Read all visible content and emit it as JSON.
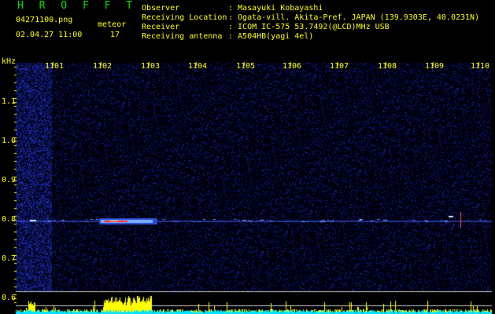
{
  "header": {
    "title": "H R O F F T",
    "filename": "04271100.png",
    "datetime": "02.04.27 11:00",
    "meteor_label": "meteor",
    "meteor_count": "17",
    "info": [
      {
        "label": "Observer",
        "value": ": Masayuki Kobayashi"
      },
      {
        "label": "Receiving Location",
        "value": ": Ogata-vill. Akita-Pref. JAPAN (139.9303E, 40.0231N)"
      },
      {
        "label": "Receiver",
        "value": ": ICOM IC-575 53.7492(@LCD)MHz USB"
      },
      {
        "label": "Receiving antenna",
        "value": ": A504HB(yagi 4el)"
      }
    ]
  },
  "axes": {
    "y_unit": "kHz",
    "y_ticks": [
      "1.1",
      "1.0",
      "0.9",
      "0.8",
      "0.7",
      "0.6"
    ],
    "x_ticks": [
      "1101",
      "1102",
      "1103",
      "1104",
      "1105",
      "1106",
      "1107",
      "1108",
      "1109",
      "1110"
    ]
  },
  "colors": {
    "text": "#ffff00",
    "title": "#00e000",
    "background": "#000000",
    "noise": "#1a2a9a",
    "echo_core": "#ff3030",
    "bars": "#ffff00",
    "baseline": "#00e0ff"
  }
}
